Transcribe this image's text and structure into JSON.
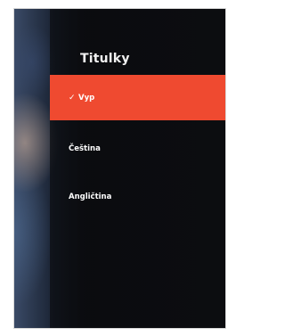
{
  "panel": {
    "title": "Titulky",
    "accent_color": "#ef4a30",
    "items": [
      {
        "label": "Vyp",
        "selected": true,
        "check_icon": "✓"
      },
      {
        "label": "Čeština",
        "selected": false
      },
      {
        "label": "Angličtina",
        "selected": false
      }
    ]
  }
}
